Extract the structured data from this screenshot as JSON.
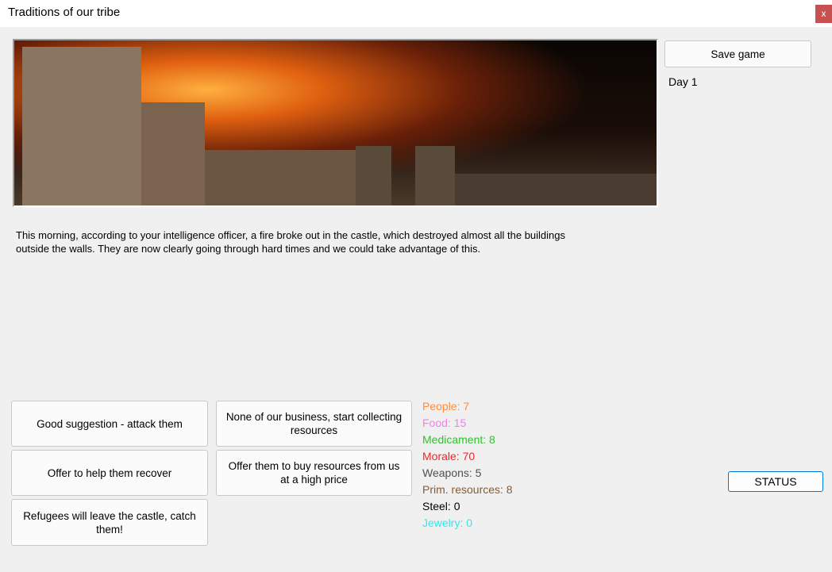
{
  "window": {
    "title": "Traditions of our tribe",
    "close_label": "x"
  },
  "header": {
    "save_label": "Save game",
    "day": "Day 1"
  },
  "event": {
    "description": "This morning, according to your intelligence officer, a fire broke out in the castle, which destroyed almost all the buildings outside the walls. They are now clearly going through hard times and we could take advantage of this."
  },
  "choices": [
    "Good suggestion - attack them",
    "None of our business, start collecting resources",
    "Offer to help them recover",
    "Offer them to buy resources from us at a high price",
    "Refugees will leave the castle, catch them!"
  ],
  "stats": [
    {
      "label": "People: 7",
      "color": "#ff8c3c"
    },
    {
      "label": "Food: 15",
      "color": "#f080f0"
    },
    {
      "label": "Medicament: 8",
      "color": "#30c030"
    },
    {
      "label": "Morale: 70",
      "color": "#ff2020"
    },
    {
      "label": "Weapons: 5",
      "color": "#505050"
    },
    {
      "label": "Prim. resources: 8",
      "color": "#8a5a30"
    },
    {
      "label": "Steel: 0",
      "color": "#000000"
    },
    {
      "label": "Jewelry: 0",
      "color": "#30e8f0"
    }
  ],
  "status_label": "STATUS"
}
